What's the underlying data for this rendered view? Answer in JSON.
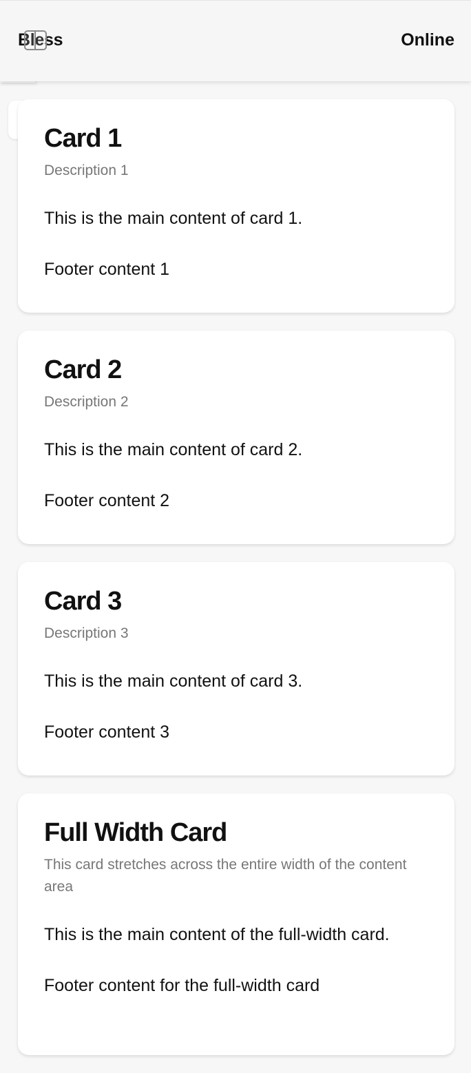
{
  "header": {
    "brand": "Bless",
    "status": "Online",
    "menu_icon": "menu-icon"
  },
  "cards": [
    {
      "title": "Card 1",
      "description": "Description 1",
      "content": "This is the main content of card 1.",
      "footer": "Footer content 1"
    },
    {
      "title": "Card 2",
      "description": "Description 2",
      "content": "This is the main content of card 2.",
      "footer": "Footer content 2"
    },
    {
      "title": "Card 3",
      "description": "Description 3",
      "content": "This is the main content of card 3.",
      "footer": "Footer content 3"
    },
    {
      "title": "Full Width Card",
      "description": "This card stretches across the entire width of the content area",
      "content": "This is the main content of the full-width card.",
      "footer": "Footer content for the full-width card"
    }
  ]
}
